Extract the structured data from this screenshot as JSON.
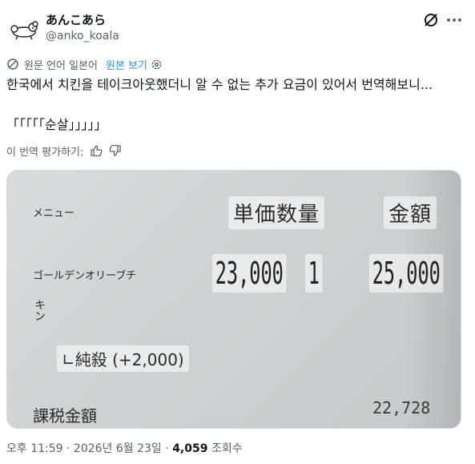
{
  "post": {
    "display_name": "あんこあら",
    "handle": "@anko_koala",
    "translation": {
      "original_language": "원문 언어 일본어",
      "show_original": "원본 보기"
    },
    "text_line1": "한국에서 치킨을 테이크아웃했더니 알 수 없는 추가 요금이 있어서 번역해보니...",
    "text_line2": "「「「「「순살」」」」」",
    "rate_translation": "이 번역 평가하기:",
    "meta": {
      "time": "오후 11:59",
      "separator": "·",
      "date": "2026년 6월 23일",
      "views_count": "4,059",
      "views_label": "조회수"
    }
  },
  "receipt": {
    "menu_label": "メニュー",
    "unit_price_qty": "単価数量",
    "amount": "金額",
    "item_name": "ゴールデンオリーブチ",
    "unit_price": "23,000",
    "quantity": "1",
    "line_amount": "25,000",
    "handwritten": "キン",
    "option": "∟純殺 (+2,000)",
    "taxable_label": "課税金額",
    "taxable_value": "22,728"
  },
  "icons": {
    "avatar": "koala-avatar",
    "grok": "grok-icon",
    "more": "more-icon",
    "translate": "translate-icon",
    "gear": "gear-icon",
    "thumbs_up": "thumbs-up-icon",
    "thumbs_down": "thumbs-down-icon"
  },
  "colors": {
    "link": "#1d9bf0",
    "secondary_text": "#536471",
    "primary_text": "#0f1419"
  }
}
